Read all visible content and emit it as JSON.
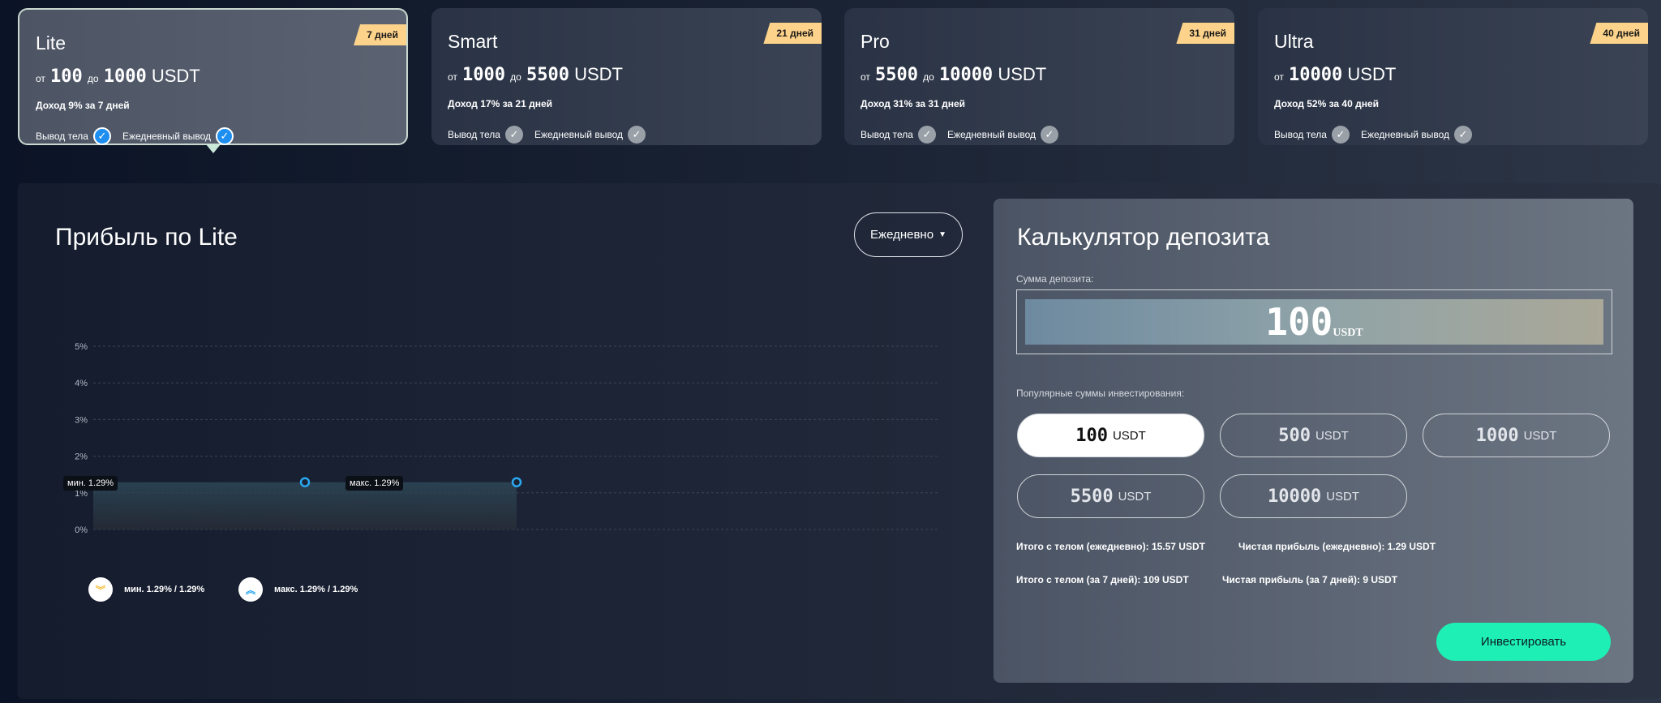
{
  "plans": [
    {
      "name": "Lite",
      "days": "7 дней",
      "from": "100",
      "to": "1000",
      "currency": "USDT",
      "income": "Доход 9% за 7 дней",
      "active": true
    },
    {
      "name": "Smart",
      "days": "21 дней",
      "from": "1000",
      "to": "5500",
      "currency": "USDT",
      "income": "Доход 17% за 21 дней",
      "active": false
    },
    {
      "name": "Pro",
      "days": "31 дней",
      "from": "5500",
      "to": "10000",
      "currency": "USDT",
      "income": "Доход 31% за 31 дней",
      "active": false
    },
    {
      "name": "Ultra",
      "days": "40 дней",
      "from": "10000",
      "to": null,
      "currency": "USDT",
      "income": "Доход 52% за 40 дней",
      "active": false
    }
  ],
  "labels": {
    "from": "от",
    "to": "до",
    "body_withdraw": "Вывод тела",
    "daily_withdraw": "Ежедневный вывод"
  },
  "profit": {
    "title": "Прибыль по Lite",
    "period": "Ежедневно"
  },
  "chart_data": {
    "type": "line",
    "ylim": [
      0,
      5
    ],
    "yticks": [
      "5%",
      "4%",
      "3%",
      "2%",
      "1%",
      "0%"
    ],
    "grid": true,
    "values": [
      1.29,
      1.29,
      1.29
    ],
    "min_label": "мин. 1.29%",
    "max_label": "макс. 1.29%",
    "legend": [
      {
        "text": "мин. 1.29% / 1.29%",
        "color": "#f5c242"
      },
      {
        "text": "макс. 1.29% / 1.29%",
        "color": "#2aa8f0"
      }
    ]
  },
  "calc": {
    "title": "Калькулятор депозита",
    "deposit_label": "Сумма депозита:",
    "deposit_value": "100",
    "deposit_unit": "USDT",
    "popular_label": "Популярные суммы инвестирования:",
    "amounts": [
      "100",
      "500",
      "1000",
      "5500",
      "10000"
    ],
    "amount_unit": "USDT",
    "total_daily": "Итого с телом (ежедневно): 15.57 USDT",
    "net_daily": "Чистая прибыль (ежедневно): 1.29 USDT",
    "total_period": "Итого с телом (за 7 дней): 109 USDT",
    "net_period": "Чистая прибыль (за 7 дней): 9 USDT",
    "invest": "Инвестировать"
  },
  "colors": {
    "accent": "#1ef0b5",
    "badge": "#fdd28a",
    "check_active": "#1e8ff0"
  }
}
